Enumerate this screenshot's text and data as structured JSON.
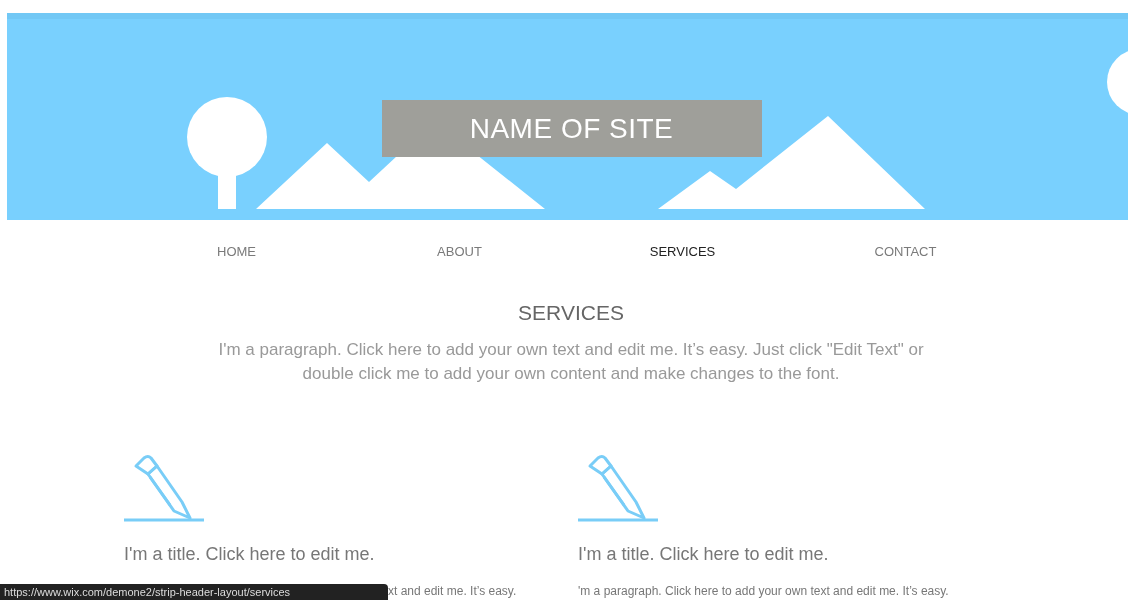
{
  "banner": {
    "site_name": "NAME OF SITE"
  },
  "nav": [
    {
      "label": "HOME",
      "selected": false
    },
    {
      "label": "ABOUT",
      "selected": false
    },
    {
      "label": "SERVICES",
      "selected": true
    },
    {
      "label": "CONTACT",
      "selected": false
    }
  ],
  "section": {
    "heading": "SERVICES",
    "paragraph": "I'm a paragraph. Click here to add your own text and edit me. It’s easy. Just click \"Edit Text\" or double click me to add your own content and make changes to the font."
  },
  "cards": [
    {
      "title": "I'm a title. Click here to edit me.",
      "paragraph": "xt and edit me. It’s easy."
    },
    {
      "title": "I'm a title. Click here to edit me.",
      "paragraph": "'m a paragraph. Click here to add your own text and edit me. It’s easy."
    }
  ],
  "status_bar": {
    "url": "https://www.wix.com/demone2/strip-header-layout/services"
  }
}
